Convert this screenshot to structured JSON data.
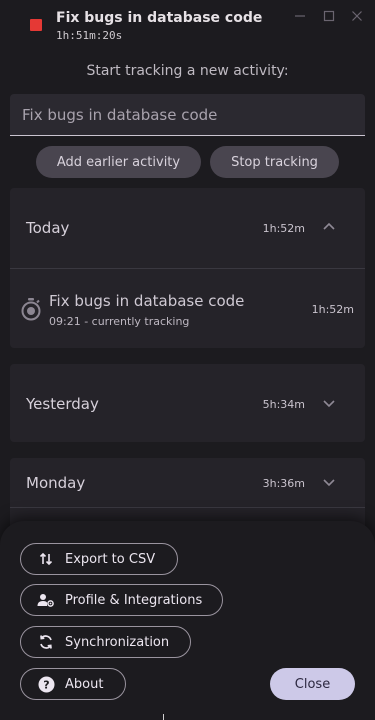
{
  "titlebar": {
    "current_activity": "Fix bugs in database code",
    "elapsed": "1h:51m:20s",
    "stop_color": "#e53935"
  },
  "prompt": "Start tracking a new activity:",
  "activity_input": {
    "value": "",
    "placeholder": "Fix bugs in database code"
  },
  "actions": {
    "add_earlier": "Add earlier activity",
    "stop_tracking": "Stop tracking"
  },
  "days": [
    {
      "label": "Today",
      "total": "1h:52m",
      "expanded": true,
      "entries": [
        {
          "title": "Fix bugs in database code",
          "subtitle": "09:21 - currently tracking",
          "duration": "1h:52m",
          "icon": "timer-icon"
        }
      ]
    },
    {
      "label": "Yesterday",
      "total": "5h:34m",
      "expanded": false
    },
    {
      "label": "Monday",
      "total": "3h:36m",
      "expanded": false
    }
  ],
  "sheet": {
    "export": "Export to CSV",
    "profile": "Profile & Integrations",
    "sync": "Synchronization",
    "about": "About",
    "close": "Close"
  },
  "colors": {
    "background": "#1c1b1f",
    "card": "#252329",
    "pill": "#49454f",
    "close_button": "#cdc9e8"
  }
}
